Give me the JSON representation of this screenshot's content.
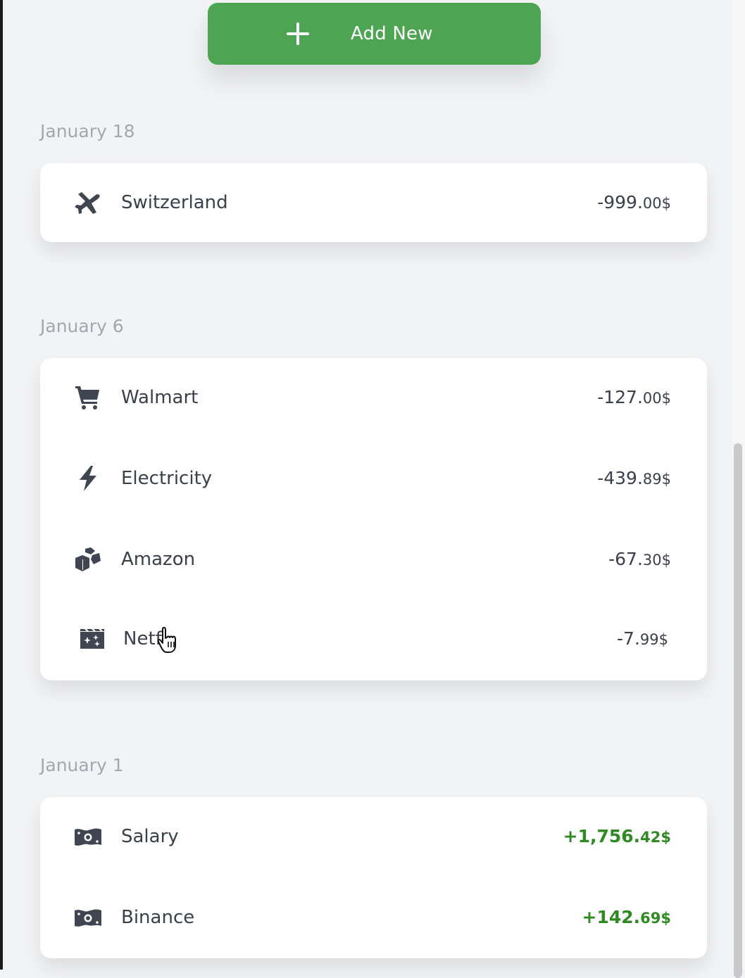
{
  "add_button": {
    "label": "Add New",
    "icon": "plus-icon"
  },
  "groups": [
    {
      "date": "January 18",
      "items": [
        {
          "icon": "airplane-icon",
          "name": "Switzerland",
          "amount_main": "-999.",
          "amount_cents": "00$",
          "type": "expense"
        }
      ]
    },
    {
      "date": "January 6",
      "items": [
        {
          "icon": "shopping-cart-icon",
          "name": "Walmart",
          "amount_main": "-127.",
          "amount_cents": "00$",
          "type": "expense"
        },
        {
          "icon": "lightning-bolt-icon",
          "name": "Electricity",
          "amount_main": "-439.",
          "amount_cents": "89$",
          "type": "expense"
        },
        {
          "icon": "boxes-icon",
          "name": "Amazon",
          "amount_main": "-67.",
          "amount_cents": "30$",
          "type": "expense"
        },
        {
          "icon": "film-clapper-icon",
          "name": "Netf",
          "amount_main": "-7.",
          "amount_cents": "99$",
          "type": "expense"
        }
      ]
    },
    {
      "date": "January 1",
      "items": [
        {
          "icon": "money-bill-icon",
          "name": "Salary",
          "amount_main": "+1,756.",
          "amount_cents": "42$",
          "type": "income"
        },
        {
          "icon": "money-bill-icon",
          "name": "Binance",
          "amount_main": "+142.",
          "amount_cents": "69$",
          "type": "income"
        }
      ]
    }
  ],
  "colors": {
    "background": "#f2f3f5",
    "button": "#4da553",
    "income": "#2f8a23",
    "text": "#3a3f4b",
    "date": "#a3a7b0",
    "icon": "#3f4551"
  }
}
